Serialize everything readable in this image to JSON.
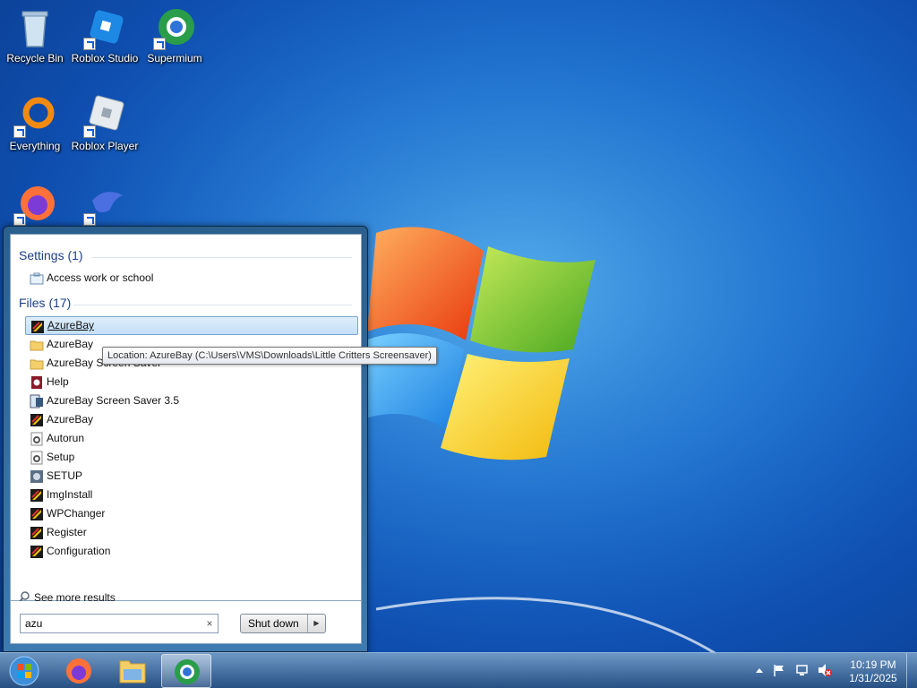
{
  "desktop": {
    "icons": [
      {
        "label": "Recycle Bin",
        "icon": "recycle-bin-icon"
      },
      {
        "label": "Roblox Studio",
        "icon": "roblox-studio-icon"
      },
      {
        "label": "Supermium",
        "icon": "supermium-icon"
      },
      {
        "label": "Everything",
        "icon": "everything-icon"
      },
      {
        "label": "Roblox Player",
        "icon": "roblox-player-icon"
      },
      {
        "label": "",
        "icon": "firefox-icon"
      },
      {
        "label": "",
        "icon": "bird-app-icon"
      }
    ]
  },
  "start_menu": {
    "groups": [
      {
        "title": "Settings (1)",
        "items": [
          {
            "label": "Access work or school",
            "icon": "briefcase-icon"
          }
        ]
      },
      {
        "title": "Files (17)",
        "items": [
          {
            "label": "AzureBay",
            "icon": "screensaver-icon"
          },
          {
            "label": "AzureBay",
            "icon": "folder-icon"
          },
          {
            "label": "AzureBay Screen Saver",
            "icon": "folder-icon"
          },
          {
            "label": "Help",
            "icon": "help-file-icon"
          },
          {
            "label": "AzureBay Screen Saver 3.5",
            "icon": "installer-icon"
          },
          {
            "label": "AzureBay",
            "icon": "screensaver-icon"
          },
          {
            "label": "Autorun",
            "icon": "settings-file-icon"
          },
          {
            "label": "Setup",
            "icon": "settings-file-icon"
          },
          {
            "label": "SETUP",
            "icon": "setup-exe-icon"
          },
          {
            "label": "ImgInstall",
            "icon": "screensaver-icon"
          },
          {
            "label": "WPChanger",
            "icon": "screensaver-icon"
          },
          {
            "label": "Register",
            "icon": "screensaver-icon"
          },
          {
            "label": "Configuration",
            "icon": "screensaver-icon"
          }
        ]
      }
    ],
    "see_more": "See more results",
    "search_value": "azu",
    "clear_glyph": "×",
    "shutdown_label": "Shut down",
    "shutdown_arrow": "▶",
    "tooltip": "Location: AzureBay (C:\\Users\\VMS\\Downloads\\Little Critters Screensaver)"
  },
  "taskbar": {
    "pinned": [
      "firefox-icon",
      "file-explorer-icon",
      "supermium-icon"
    ],
    "tray_icons": [
      "show-hidden-icons-icon",
      "action-center-flag-icon",
      "network-icon",
      "volume-muted-icon"
    ],
    "time": "10:19 PM",
    "date": "1/31/2025"
  }
}
